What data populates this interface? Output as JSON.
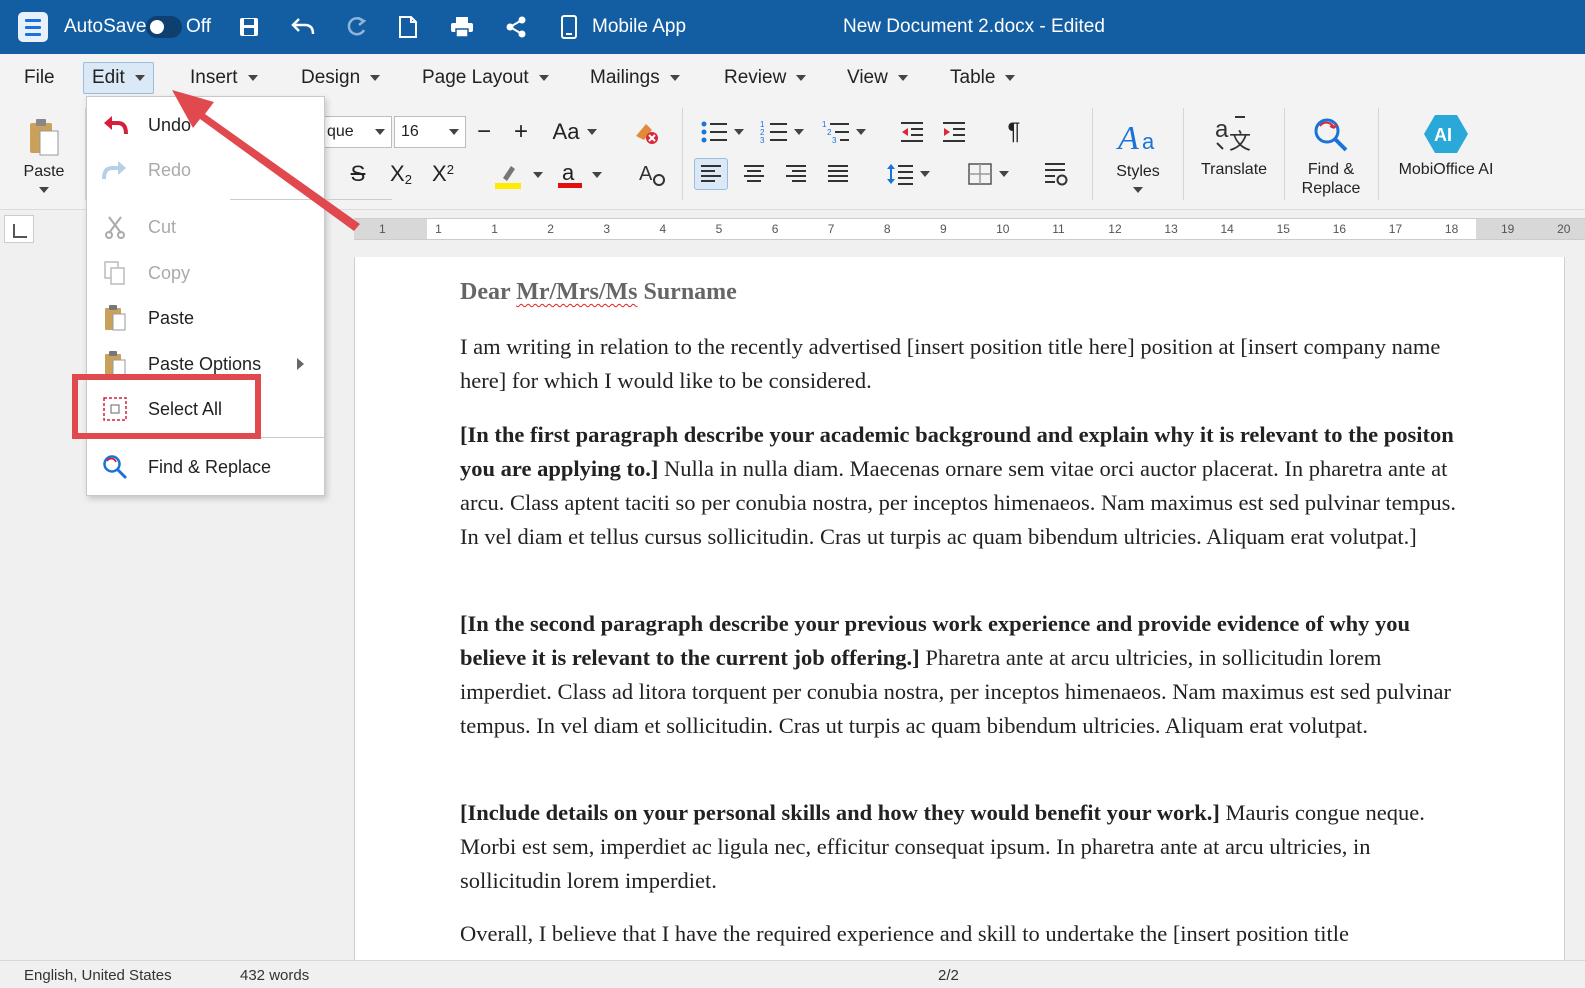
{
  "titlebar": {
    "autosave_label": "AutoSave",
    "autosave_state": "Off",
    "mobile_app_label": "Mobile App",
    "document_title": "New Document 2.docx - Edited"
  },
  "menubar": {
    "file": "File",
    "edit": "Edit",
    "insert": "Insert",
    "design": "Design",
    "page_layout": "Page Layout",
    "mailings": "Mailings",
    "review": "Review",
    "view": "View",
    "table": "Table"
  },
  "ribbon": {
    "paste_label": "Paste",
    "font_name_partial": "que",
    "font_size": "16",
    "case_label": "Aa",
    "styles_label": "Styles",
    "translate_label": "Translate",
    "find_replace_line1": "Find &",
    "find_replace_line2": "Replace",
    "mobioffice_ai_label": "MobiOffice AI",
    "ai_badge": "AI",
    "highlight_color": "#ffeb00",
    "font_color": "#e01010"
  },
  "ruler": {
    "numbers": [
      "1",
      "1",
      "1",
      "2",
      "3",
      "4",
      "5",
      "6",
      "7",
      "8",
      "9",
      "10",
      "11",
      "12",
      "13",
      "14",
      "15",
      "16",
      "17",
      "18",
      "19",
      "20"
    ]
  },
  "edit_menu": {
    "undo": "Undo",
    "redo": "Redo",
    "cut": "Cut",
    "copy": "Copy",
    "paste": "Paste",
    "paste_options": "Paste Options",
    "select_all": "Select All",
    "find_replace": "Find & Replace"
  },
  "document": {
    "salutation_prefix": "Dear",
    "salutation_name": "Mr/Mrs/Ms",
    "salutation_suffix": "Surname",
    "p1": "I am writing in relation to the recently advertised [insert position title here] position at [insert company name here] for which I would like to be considered.",
    "p2_bold": "[In the first paragraph describe your academic background and explain why it is relevant to the positon you are applying to.]",
    "p2_body": "Nulla in nulla diam. Maecenas ornare sem vitae orci auctor placerat. In pharetra ante at arcu. Class aptent taciti so per conubia nostra, per inceptos himenaeos. Nam maximus est sed pulvinar tempus. In vel diam et tellus cursus sollicitudin. Cras ut turpis ac quam bibendum ultricies. Aliquam erat volutpat.]",
    "p3_bold": "[In the second paragraph describe your previous work experience and provide evidence of why you believe it is relevant to the current job offering.]",
    "p3_body": "Pharetra ante at arcu ultricies, in sollicitudin lorem imperdiet. Class ad litora torquent per conubia nostra, per inceptos himenaeos. Nam maximus est sed pulvinar tempus. In vel diam et sollicitudin. Cras ut turpis ac quam bibendum ultricies. Aliquam erat volutpat.",
    "p4_bold": "[Include details on your personal skills and how they would benefit your work.]",
    "p4_body": "Mauris congue neque. Morbi est sem, imperdiet ac ligula nec, efficitur consequat ipsum. In pharetra ante at arcu ultricies, in sollicitudin lorem imperdiet.",
    "p5": "Overall, I believe that I have the required experience and skill to undertake the [insert position title"
  },
  "statusbar": {
    "language_partial": "English, United States",
    "words_partial": "432 words",
    "page_partial": "2/2"
  },
  "colors": {
    "titlebar_bg": "#135ea3",
    "annotation_red": "#e04a4f",
    "spell_squiggle": "#e02020",
    "undo_red": "#d61f3c"
  }
}
